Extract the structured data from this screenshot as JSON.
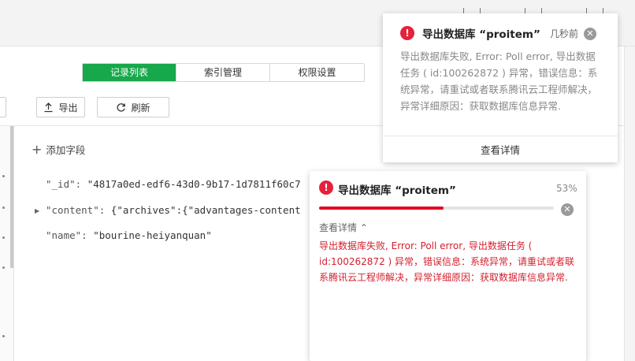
{
  "tabs": [
    {
      "label": "记录列表",
      "active": true
    },
    {
      "label": "索引管理",
      "active": false
    },
    {
      "label": "权限设置",
      "active": false
    }
  ],
  "toolbar": {
    "export_label": "导出",
    "refresh_label": "刷新"
  },
  "document": {
    "add_field_label": "添加字段",
    "fields": [
      {
        "key": "\"_id\":",
        "value": "\"4817a0ed-edf6-43d0-9b17-1d7811f60c7"
      },
      {
        "key": "\"content\":",
        "value": "{\"archives\":{\"advantages-content"
      },
      {
        "key": "\"name\":",
        "value": "\"bourine-heiyanquan\""
      }
    ]
  },
  "notification_top": {
    "title": "导出数据库 “proitem”",
    "time": "几秒前",
    "message": "导出数据库失败, Error: Poll error, 导出数据任务 ( id:100262872 ) 异常，错误信息：系统异常，请重试或者联系腾讯云工程师解决，异常详细原因：获取数据库信息异常.",
    "link_label": "查看详情"
  },
  "notification_progress": {
    "title": "导出数据库 “proitem”",
    "percent_label": "53%",
    "progress": 0.53,
    "toggle_label": "查看详情",
    "message": "导出数据库失败, Error: Poll error, 导出数据任务 ( id:100262872 ) 异常，错误信息：系统异常，请重试或者联系腾讯云工程师解决，异常详细原因：获取数据库信息异常."
  },
  "colors": {
    "accent": "#16a84a",
    "error": "#e6213b",
    "progress": "#e00c1f",
    "error_text": "#d4202f"
  },
  "icons": {
    "export": "upload-icon",
    "refresh": "refresh-icon",
    "add": "plus-icon",
    "error": "error-circle-icon",
    "close": "close-circle-icon",
    "toggle": "chevron-up-icon"
  }
}
